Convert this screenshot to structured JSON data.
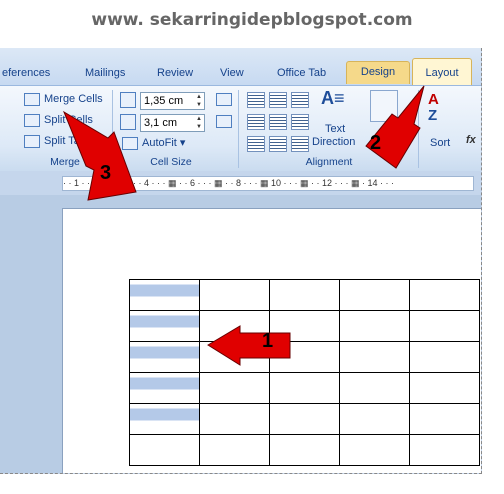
{
  "watermark": "www. sekarringidepblogspot.com",
  "tabs": [
    {
      "label": "eferences"
    },
    {
      "label": "Mailings"
    },
    {
      "label": "Review"
    },
    {
      "label": "View"
    },
    {
      "label": "Office Tab"
    },
    {
      "label": "Design"
    },
    {
      "label": "Layout"
    }
  ],
  "merge_group": {
    "merge_cells": "Merge Cells",
    "split_cells": "Split Cells",
    "split_table": "Split Table",
    "label": "Merge"
  },
  "cell_size": {
    "height": "1,35 cm",
    "width": "3,1 cm",
    "autofit": "AutoFit",
    "label": "Cell Size"
  },
  "alignment": {
    "text_direction_line1": "Text",
    "text_direction_line2": "Direction",
    "label": "Alignment"
  },
  "data_group": {
    "sort": "Sort"
  },
  "ruler_text": "· · 1 · · · 2 · · · ▦ · · 4 · · · ▦ · · 6 · · · ▦ · · 8 · · · ▦ 10 · · · ▦ · · 12 · · · ▦ · 14 · · ·",
  "callouts": {
    "one": "1",
    "two": "2",
    "three": "3"
  },
  "table": {
    "rows": 6,
    "cols": 5,
    "highlighted_rows": 5
  }
}
